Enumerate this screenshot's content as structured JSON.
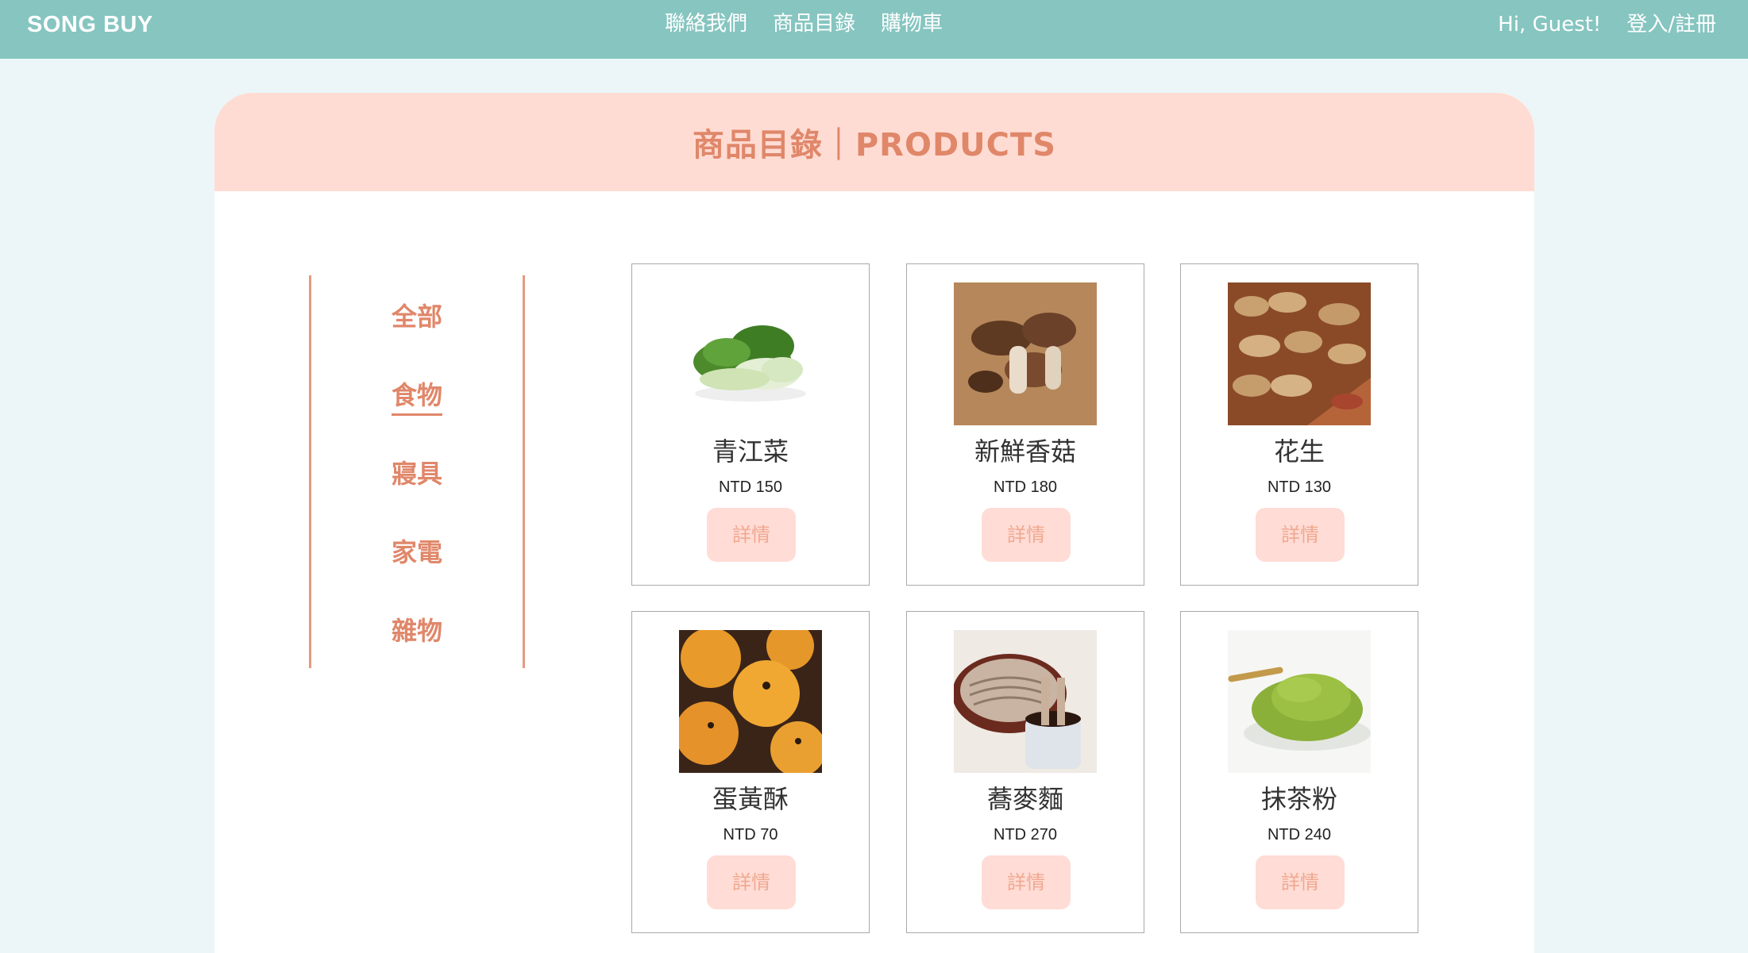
{
  "navbar": {
    "brand": "SONG BUY",
    "links": [
      "聯絡我們",
      "商品目錄",
      "購物車"
    ],
    "greeting": "Hi, Guest!",
    "login": "登入/註冊"
  },
  "catalog": {
    "title": "商品目錄｜PRODUCTS",
    "categories": [
      "全部",
      "食物",
      "寢具",
      "家電",
      "雜物"
    ],
    "active_category": "食物"
  },
  "products": [
    {
      "name": "青江菜",
      "price": "NTD 150",
      "button": "詳情",
      "image": "bok-choy-image"
    },
    {
      "name": "新鮮香菇",
      "price": "NTD 180",
      "button": "詳情",
      "image": "shiitake-image"
    },
    {
      "name": "花生",
      "price": "NTD 130",
      "button": "詳情",
      "image": "peanut-image"
    },
    {
      "name": "蛋黃酥",
      "price": "NTD 70",
      "button": "詳情",
      "image": "yolk-pastry-image"
    },
    {
      "name": "蕎麥麵",
      "price": "NTD 270",
      "button": "詳情",
      "image": "soba-image"
    },
    {
      "name": "抹茶粉",
      "price": "NTD 240",
      "button": "詳情",
      "image": "matcha-image"
    }
  ],
  "colors": {
    "navbar_bg": "#86c5c0",
    "page_bg": "#ecf6f8",
    "header_bg": "#ffdcd3",
    "accent": "#e0876a",
    "button_bg": "#ffdcd5"
  }
}
